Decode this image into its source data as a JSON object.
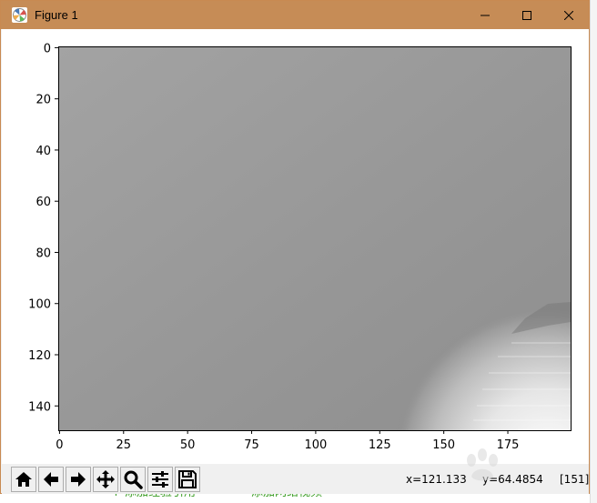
{
  "window": {
    "title": "Figure 1",
    "icons": {
      "app": "matplotlib-figure-icon",
      "minimize": "minimize-icon",
      "maximize": "maximize-icon",
      "close": "close-icon"
    },
    "titlebar_color": "#c68c56"
  },
  "plot": {
    "type": "image",
    "x_ticks": [
      "0",
      "25",
      "50",
      "75",
      "100",
      "125",
      "150",
      "175"
    ],
    "y_ticks": [
      "0",
      "20",
      "40",
      "60",
      "80",
      "100",
      "120",
      "140"
    ],
    "x_range": [
      -0.5,
      199.5
    ],
    "y_range": [
      149.5,
      -0.5
    ],
    "colormap": "gray"
  },
  "toolbar": {
    "buttons": [
      {
        "name": "home-icon"
      },
      {
        "name": "back-icon"
      },
      {
        "name": "forward-icon"
      },
      {
        "name": "pan-icon"
      },
      {
        "name": "zoom-icon"
      },
      {
        "name": "configure-subplots-icon"
      },
      {
        "name": "save-icon"
      }
    ],
    "coord_x": "x=121.133",
    "coord_y": "y=64.4854",
    "pixel_value": "[151]"
  },
  "background": {
    "left_text": "+ 添加经验引用",
    "right_text": "添加网络视频"
  }
}
